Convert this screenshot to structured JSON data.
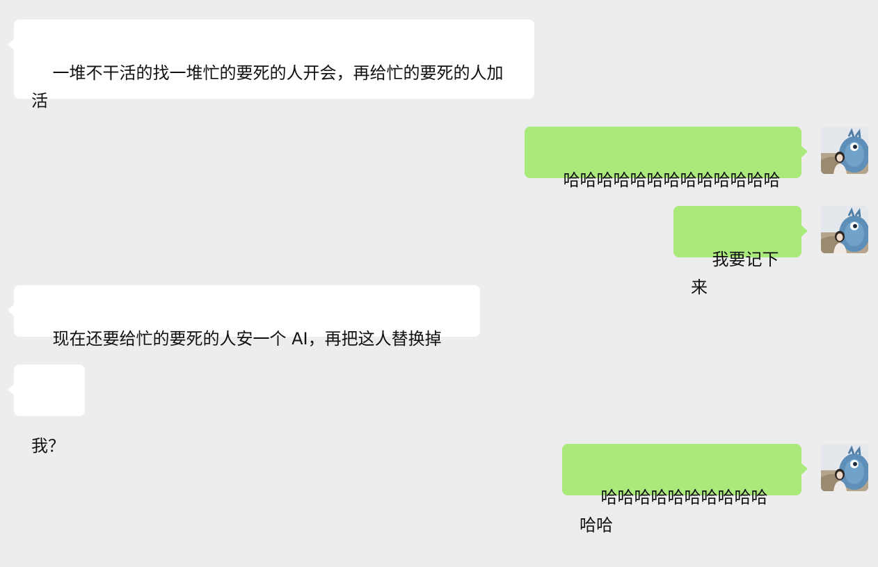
{
  "chat": {
    "messages": [
      {
        "side": "received",
        "text": "一堆不干活的找一堆忙的要死的人开会，再给忙的要死的人加活"
      },
      {
        "side": "sent",
        "text": "哈哈哈哈哈哈哈哈哈哈哈哈哈",
        "avatar": "user-photo-avatar-icon"
      },
      {
        "side": "sent",
        "text": "我要记下来",
        "avatar": "user-photo-avatar-icon"
      },
      {
        "side": "received",
        "text": "现在还要给忙的要死的人安一个 AI，再把这人替换掉"
      },
      {
        "side": "received",
        "text": "我？"
      },
      {
        "side": "sent",
        "text": "哈哈哈哈哈哈哈哈哈哈哈哈",
        "avatar": "user-photo-avatar-icon"
      }
    ]
  },
  "colors": {
    "background": "#ededed",
    "received_bubble": "#ffffff",
    "sent_bubble": "#a9ea7a",
    "text": "#111111"
  }
}
